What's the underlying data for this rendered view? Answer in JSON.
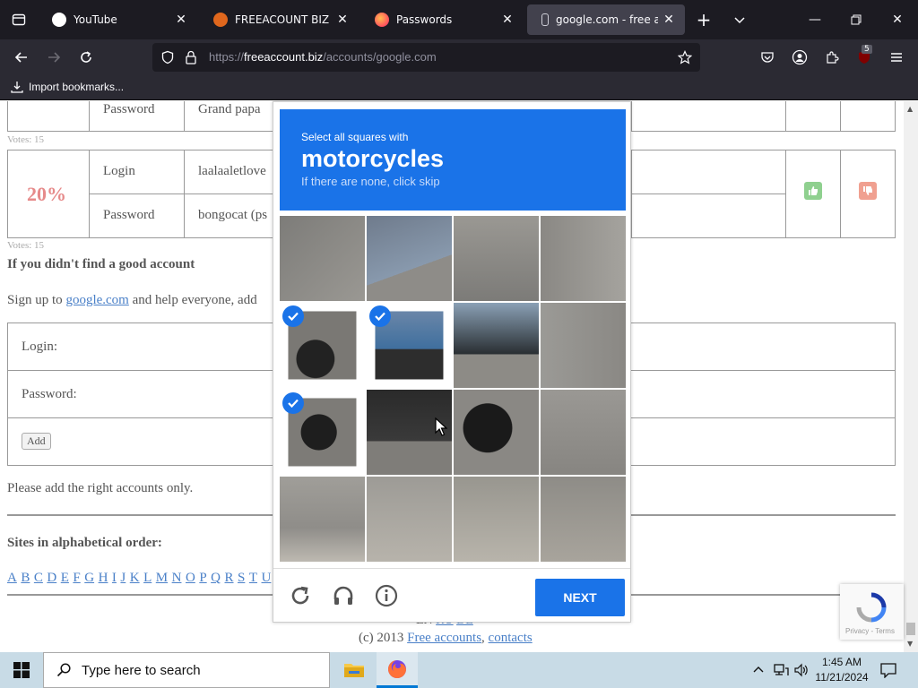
{
  "browser": {
    "tabs": [
      {
        "title": "YouTube",
        "favicon_color": "#ffffff",
        "active": false
      },
      {
        "title": "FREEACOUNT BIZ at Du",
        "favicon_color": "#e0671d",
        "active": false
      },
      {
        "title": "Passwords",
        "favicon_color": "#ff7139",
        "active": false
      },
      {
        "title": "google.com - free acco",
        "favicon_color": "#cfcfd8",
        "active": true
      }
    ],
    "url": {
      "prefix": "https://",
      "domain": "freeaccount.biz",
      "path": "/accounts/google.com"
    },
    "bookmarks_label": "Import bookmarks...",
    "extension_badge": "5"
  },
  "page": {
    "row1": {
      "password_label": "Password",
      "password_value": "Grand papa"
    },
    "votes1": "Votes: 15",
    "row2": {
      "percent": "20%",
      "login_label": "Login",
      "login_value": "laalaaletlove",
      "password_label": "Password",
      "password_value": "bongocat (ps"
    },
    "votes2": "Votes: 15",
    "not_found_heading": "If you didn't find a good account",
    "signup": {
      "prefix": "Sign up to ",
      "link": "google.com",
      "suffix": " and help everyone, add"
    },
    "form": {
      "login_label": "Login:",
      "password_label": "Password:",
      "add_button": "Add"
    },
    "note": "Please add the right accounts only.",
    "sites_heading": "Sites in alphabetical order:",
    "alphabet": [
      "A",
      "B",
      "C",
      "D",
      "E",
      "F",
      "G",
      "H",
      "I",
      "J",
      "K",
      "L",
      "M",
      "N",
      "O",
      "P",
      "Q",
      "R",
      "S",
      "T",
      "U"
    ],
    "languages": {
      "en": "EN",
      "ru": "RU",
      "de": "DE"
    },
    "footer": {
      "prefix": "(c) 2013 ",
      "link1": "Free accounts",
      "sep": ", ",
      "link2": "contacts"
    }
  },
  "captcha": {
    "instruction": "Select all squares with",
    "target": "motorcycles",
    "hint": "If there are none, click skip",
    "next_button": "NEXT",
    "selected_tiles": [
      4,
      5,
      8
    ],
    "accent_color": "#1a73e8"
  },
  "recaptcha_badge": {
    "text": "Privacy - Terms"
  },
  "taskbar": {
    "search_placeholder": "Type here to search",
    "time": "1:45 AM",
    "date": "11/21/2024"
  }
}
